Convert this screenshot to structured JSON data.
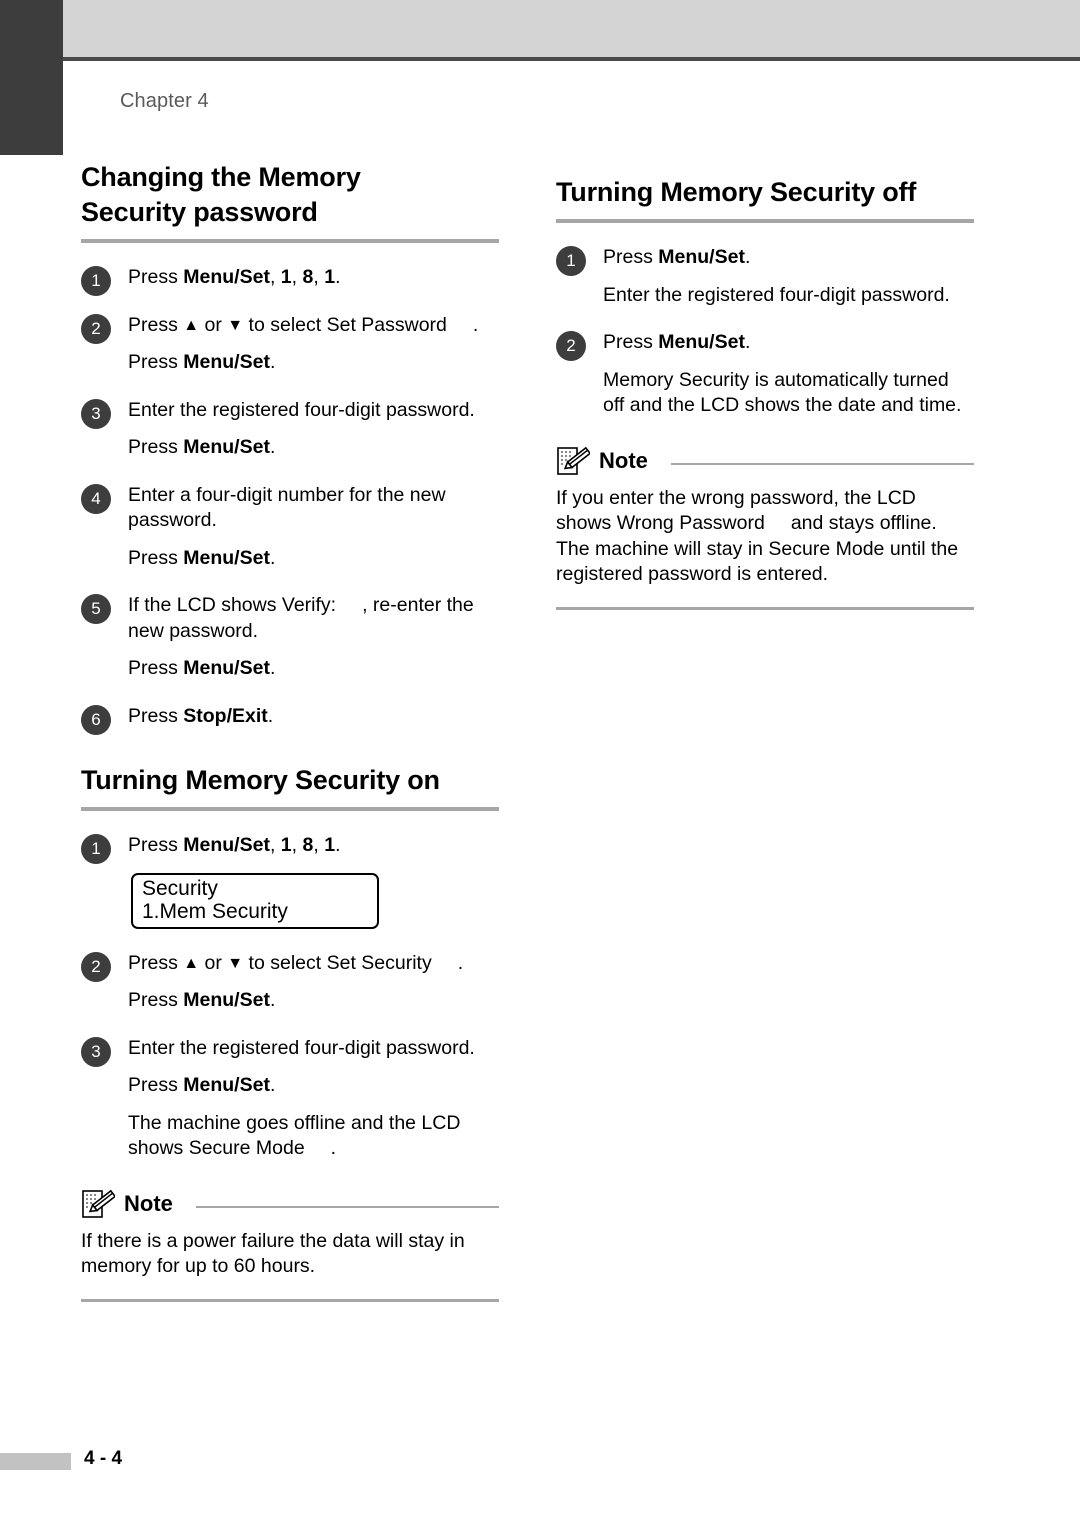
{
  "header": {
    "chapter_label": "Chapter 4",
    "tab_color": "#3d3d3d",
    "bar_color": "#d4d4d4",
    "rule_color": "#4a4a4a"
  },
  "accent": {
    "heading_rule": "#a6a6a6",
    "bullet_fill": "#3d3d3d",
    "bullet_text": "#ffffff"
  },
  "left_column": {
    "section1": {
      "heading_line1": "Changing the Memory",
      "heading_line2": "Security password",
      "steps": [
        {
          "num": "1",
          "lines": [
            {
              "pre": "Press ",
              "bold": "Menu/Set",
              "post": ", ",
              "bold2": "1",
              "post2": ", ",
              "bold3": "8",
              "post3": ", ",
              "bold4": "1",
              "post4": "."
            }
          ]
        },
        {
          "num": "2",
          "lines": [
            {
              "text_a": "Press ",
              "up": "▲",
              "text_b": " or ",
              "down": "▼",
              "text_c": " to select Set Password",
              "text_d": "."
            },
            {
              "pre": "Press ",
              "bold": "Menu/Set",
              "post": "."
            }
          ]
        },
        {
          "num": "3",
          "lines": [
            {
              "text": "Enter the registered four-digit password."
            },
            {
              "pre": "Press ",
              "bold": "Menu/Set",
              "post": "."
            }
          ]
        },
        {
          "num": "4",
          "lines": [
            {
              "text": "Enter a four-digit number for the new password."
            },
            {
              "pre": "Press ",
              "bold": "Menu/Set",
              "post": "."
            }
          ]
        },
        {
          "num": "5",
          "lines": [
            {
              "text_a": "If the LCD shows Verify:",
              "text_d": ", re-enter the new password."
            },
            {
              "pre": "Press ",
              "bold": "Menu/Set",
              "post": "."
            }
          ]
        },
        {
          "num": "6",
          "lines": [
            {
              "pre": "Press ",
              "bold": "Stop/Exit",
              "post": "."
            }
          ]
        }
      ]
    },
    "section2": {
      "heading": "Turning Memory Security on",
      "step1": {
        "num": "1",
        "pre": "Press ",
        "bold": "Menu/Set",
        "post": ", ",
        "bold2": "1",
        "post2": ", ",
        "bold3": "8",
        "post3": ", ",
        "bold4": "1",
        "post4": "."
      },
      "lcd": {
        "line1": "Security",
        "line2": "1.Mem Security"
      },
      "step2": {
        "num": "2",
        "text_a": "Press ",
        "up": "▲",
        "text_b": " or ",
        "down": "▼",
        "text_c": " to select Set Security",
        "text_d": ".",
        "press_pre": "Press ",
        "press_bold": "Menu/Set",
        "press_post": "."
      },
      "step3": {
        "num": "3",
        "text": "Enter the registered four-digit password.",
        "press_pre": "Press ",
        "press_bold": "Menu/Set",
        "press_post": ".",
        "result_a": "The machine goes offline and the LCD shows Secure Mode",
        "result_b": "."
      },
      "note": {
        "icon": "note-pencil-icon",
        "title": "Note",
        "body": "If there is a power failure the data will stay in memory for up to 60 hours."
      }
    }
  },
  "right_column": {
    "section": {
      "heading": "Turning Memory Security off",
      "step1": {
        "num": "1",
        "pre": "Press ",
        "bold": "Menu/Set",
        "post": ".",
        "sub": "Enter the registered four-digit password."
      },
      "step2": {
        "num": "2",
        "pre": "Press ",
        "bold": "Menu/Set",
        "post": ".",
        "sub": "Memory Security is automatically turned off and the LCD shows the date and time."
      },
      "note": {
        "icon": "note-pencil-icon",
        "title": "Note",
        "body_a": "If you enter the wrong password, the LCD shows Wrong Password",
        "body_b": "and stays offline. The machine will stay in Secure Mode until the registered password is entered."
      }
    }
  },
  "footer": {
    "page_number": "4 - 4",
    "swatch_color": "#c2c2c2"
  }
}
